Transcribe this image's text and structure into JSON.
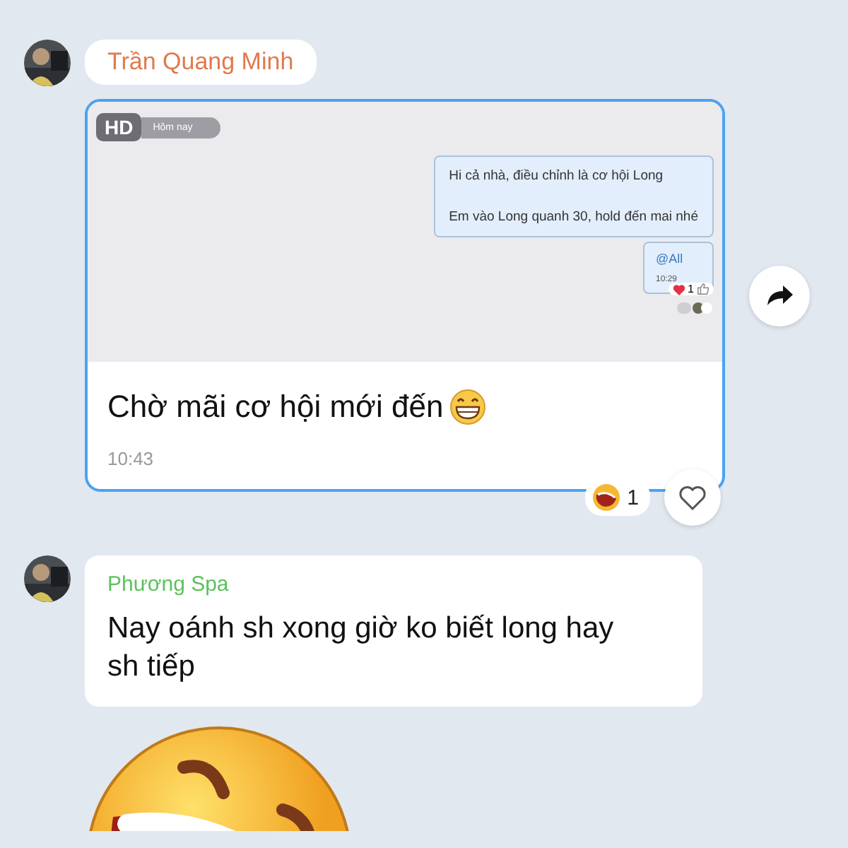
{
  "messages": [
    {
      "kind": "forward",
      "sender": "Trần Quang Minh",
      "color": "#e07a4f",
      "screenshot": {
        "badge": "HD",
        "date": "Hôm nay",
        "lines": [
          "Hi cả nhà, điều chỉnh là cơ hội Long",
          "Em vào Long quanh 30, hold đến mai nhé"
        ],
        "mention": "@All",
        "time": "10:29",
        "heart_count": "1"
      },
      "caption": "Chờ mãi cơ hội mới đến",
      "time": "10:43",
      "reaction_count": "1"
    },
    {
      "kind": "text",
      "sender": "Phương Spa",
      "color": "#5cc15c",
      "text": "Nay oánh sh xong giờ ko biết long hay sh tiếp"
    },
    {
      "kind": "sticker"
    }
  ]
}
